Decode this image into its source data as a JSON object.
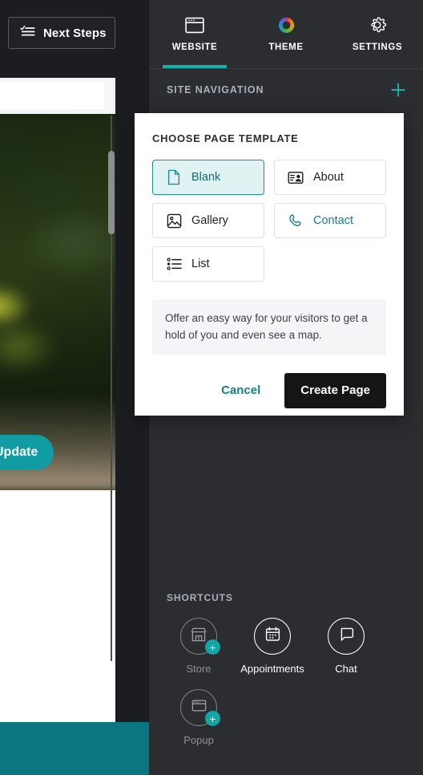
{
  "colors": {
    "accent_teal": "#14b0b0",
    "accent_teal_dark": "#0c7680",
    "panel_bg": "#2b2d31",
    "preview_bg": "#1c1d20",
    "modal_bg": "#ffffff",
    "selected_bg": "#e1f2f2",
    "create_btn_bg": "#131517"
  },
  "preview": {
    "next_steps": {
      "label": "Next Steps",
      "icon": "checklist-icon"
    },
    "update_button": {
      "label": "Update",
      "icon": "camera-icon"
    }
  },
  "panel": {
    "tabs": [
      {
        "label": "WEBSITE",
        "icon": "browser-window-icon",
        "active": true
      },
      {
        "label": "THEME",
        "icon": "color-wheel-icon",
        "active": false
      },
      {
        "label": "SETTINGS",
        "icon": "gear-icon",
        "active": false
      }
    ],
    "site_navigation": {
      "title": "SITE NAVIGATION",
      "add_icon": "plus-icon"
    },
    "shortcuts": {
      "title": "SHORTCUTS",
      "items": [
        {
          "label": "Store",
          "icon": "storefront-icon",
          "badge": "+",
          "active": false
        },
        {
          "label": "Appointments",
          "icon": "calendar-icon",
          "badge": "",
          "active": true
        },
        {
          "label": "Chat",
          "icon": "chat-bubble-icon",
          "badge": "",
          "active": true
        },
        {
          "label": "Popup",
          "icon": "popup-window-icon",
          "badge": "+",
          "active": false
        }
      ]
    }
  },
  "modal": {
    "title": "CHOOSE PAGE TEMPLATE",
    "templates": [
      {
        "label": "Blank",
        "icon": "page-icon",
        "state": "selected"
      },
      {
        "label": "About",
        "icon": "id-card-icon",
        "state": "default"
      },
      {
        "label": "Gallery",
        "icon": "image-icon",
        "state": "default"
      },
      {
        "label": "Contact",
        "icon": "phone-icon",
        "state": "hovered"
      },
      {
        "label": "List",
        "icon": "list-icon",
        "state": "default"
      }
    ],
    "description": "Offer an easy way for your visitors to get a hold of you and even see a map.",
    "cancel_label": "Cancel",
    "create_label": "Create Page"
  }
}
